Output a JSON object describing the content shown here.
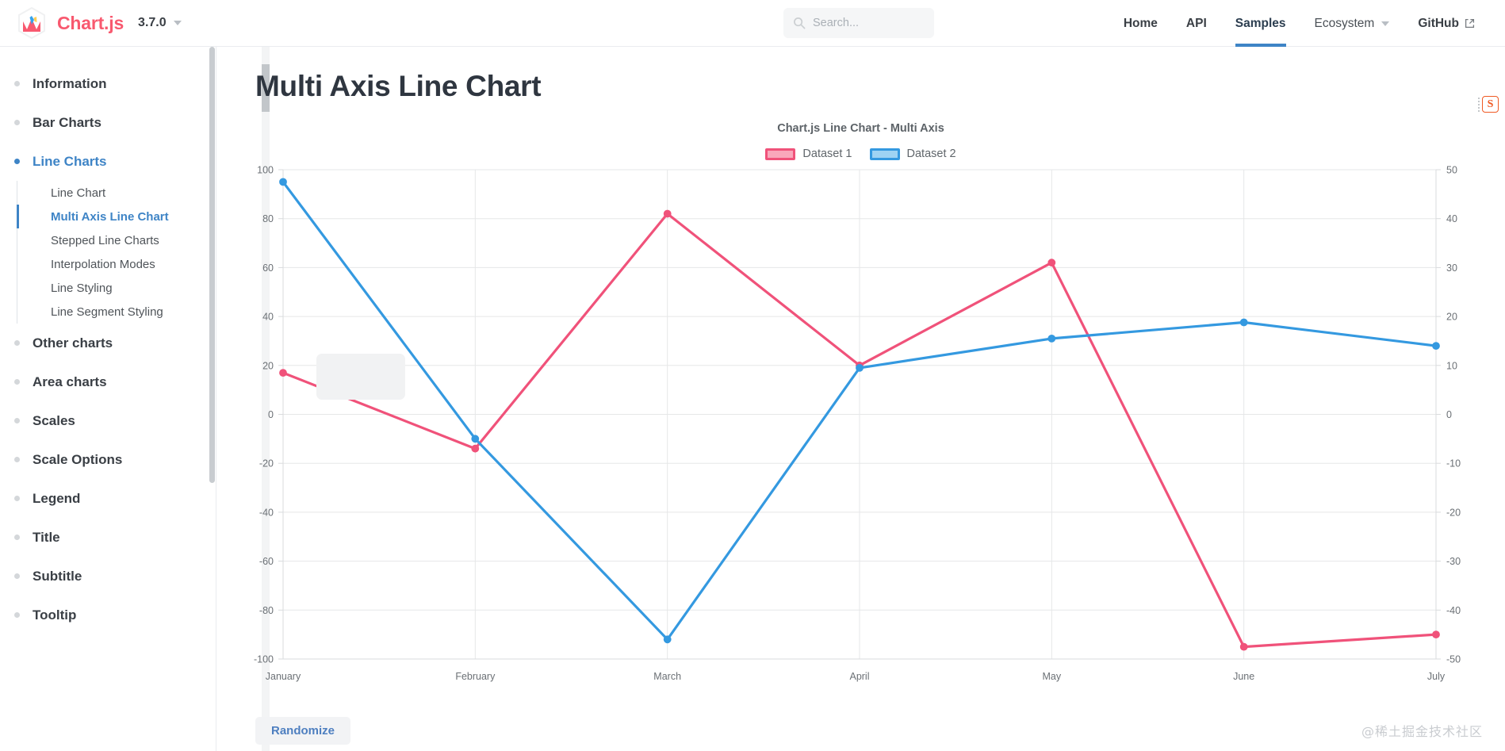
{
  "brand": {
    "name": "Chart.js",
    "version": "3.7.0",
    "logo_icon": "chartjs-hex-logo",
    "version_caret_icon": "chevron-down-icon"
  },
  "search": {
    "placeholder": "Search...",
    "value": "",
    "icon": "search-icon"
  },
  "nav": [
    {
      "label": "Home",
      "active": false,
      "dropdown": false,
      "external": false
    },
    {
      "label": "API",
      "active": false,
      "dropdown": false,
      "external": false
    },
    {
      "label": "Samples",
      "active": true,
      "dropdown": false,
      "external": false
    },
    {
      "label": "Ecosystem",
      "active": false,
      "dropdown": true,
      "external": false
    },
    {
      "label": "GitHub",
      "active": false,
      "dropdown": false,
      "external": true
    }
  ],
  "sidebar": {
    "groups": [
      {
        "label": "Information",
        "current": false
      },
      {
        "label": "Bar Charts",
        "current": false
      },
      {
        "label": "Line Charts",
        "current": true,
        "items": [
          {
            "label": "Line Chart",
            "active": false
          },
          {
            "label": "Multi Axis Line Chart",
            "active": true
          },
          {
            "label": "Stepped Line Charts",
            "active": false
          },
          {
            "label": "Interpolation Modes",
            "active": false
          },
          {
            "label": "Line Styling",
            "active": false
          },
          {
            "label": "Line Segment Styling",
            "active": false
          }
        ]
      },
      {
        "label": "Other charts",
        "current": false
      },
      {
        "label": "Area charts",
        "current": false
      },
      {
        "label": "Scales",
        "current": false
      },
      {
        "label": "Scale Options",
        "current": false
      },
      {
        "label": "Legend",
        "current": false
      },
      {
        "label": "Title",
        "current": false
      },
      {
        "label": "Subtitle",
        "current": false
      },
      {
        "label": "Tooltip",
        "current": false
      }
    ]
  },
  "main": {
    "page_title": "Multi Axis Line Chart",
    "randomize_label": "Randomize",
    "watermark": "@稀土掘金技术社区",
    "extension_badge": "S"
  },
  "chart_data": {
    "type": "line",
    "title": "Chart.js Line Chart - Multi Axis",
    "xlabel": "",
    "ylabel": "",
    "grid": true,
    "legend_position": "top",
    "categories": [
      "January",
      "February",
      "March",
      "April",
      "May",
      "June",
      "July"
    ],
    "axes": {
      "y_left": {
        "id": "y",
        "position": "left",
        "ticks": [
          100,
          80,
          60,
          40,
          20,
          0,
          -20,
          -40,
          -60,
          -80,
          -100
        ],
        "ylim": [
          -100,
          100
        ]
      },
      "y_right": {
        "id": "y1",
        "position": "right",
        "ticks": [
          50,
          40,
          30,
          20,
          10,
          0,
          -10,
          -20,
          -30,
          -40,
          -50
        ],
        "ylim": [
          -50,
          50
        ]
      }
    },
    "series": [
      {
        "name": "Dataset 1",
        "axis": "y_left",
        "color": "#f0527a",
        "point_color": "#f0527a",
        "values": [
          17,
          -14,
          82,
          20,
          62,
          -95,
          -90
        ]
      },
      {
        "name": "Dataset 2",
        "axis": "y_right",
        "color": "#3499e0",
        "point_color": "#3499e0",
        "values": [
          47.5,
          -5,
          -46,
          9.5,
          15.5,
          18.8,
          14
        ]
      }
    ],
    "colors": {
      "dataset1": "#f0527a",
      "dataset2": "#3499e0",
      "grid": "#e6e7e8",
      "tick_text": "#6b7075",
      "title_text": "#5d6368"
    }
  }
}
